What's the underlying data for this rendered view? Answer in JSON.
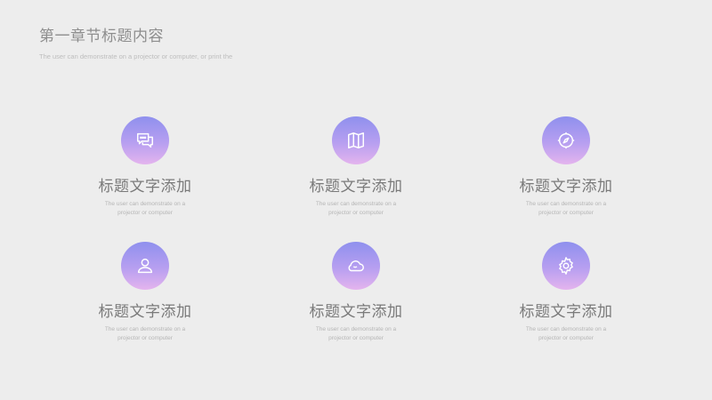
{
  "header": {
    "title": "第一章节标题内容",
    "subtitle": "The user can demonstrate on a projector or computer, or print the"
  },
  "cards": [
    {
      "title": "标题文字添加",
      "desc": "The user can demonstrate on a projector or computer",
      "icon": "chat-icon"
    },
    {
      "title": "标题文字添加",
      "desc": "The user can demonstrate on a projector or computer",
      "icon": "map-icon"
    },
    {
      "title": "标题文字添加",
      "desc": "The user can demonstrate on a projector or computer",
      "icon": "compass-icon"
    },
    {
      "title": "标题文字添加",
      "desc": "The user can demonstrate on a projector or computer",
      "icon": "user-icon"
    },
    {
      "title": "标题文字添加",
      "desc": "The user can demonstrate on a projector or computer",
      "icon": "cloud-icon"
    },
    {
      "title": "标题文字添加",
      "desc": "The user can demonstrate on a projector or computer",
      "icon": "gear-icon"
    }
  ],
  "colors": {
    "background": "#ededed",
    "gradient_top": "#8f90ee",
    "gradient_bottom": "#e4b4ee"
  }
}
